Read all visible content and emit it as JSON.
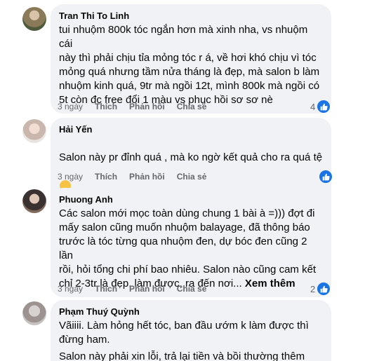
{
  "comments": [
    {
      "author": "Tran Thi To Linh",
      "text": "tui nhuộm 800k tóc ngắn hơn mà xinh nha, vs nhuộm cái\nnày thì phải chịu tỉa mỏng tóc r á, về hơi khó chịu vì tóc\nmỏng quá nhưng tầm nửa tháng là đẹp, mà salon b làm\nnhuộm kinh quá, 9tr mà ngồi 12t, mình 800k mà ngồi có\n5t còn đc free đổi 1 màu vs phục hồi sơ sơ nè",
      "time": "3 ngày",
      "like": "Thích",
      "reply": "Phản hồi",
      "share": "Chia sẻ",
      "reaction_count": "4"
    },
    {
      "author": "Hải Yến",
      "text": "Salon này pr đỉnh quá , mà ko ngờ kết quả cho ra quá tệ",
      "emoji": "crying-face-emoji",
      "time": "3 ngày",
      "like": "Thích",
      "reply": "Phản hồi",
      "share": "Chia sẻ",
      "reaction_count": ""
    },
    {
      "author": "Phuong Anh",
      "text": "Các salon mới mọc toàn dùng chung 1 bài à =))) đợt đi\nmấy salon cũng muốn nhuộm balayage, đã thông báo\ntrước là tóc từng qua nhuộm đen, dự bóc đen cũng 2 lần\nrồi, hỏi tổng chi phí bao nhiêu. Salon nào cũng cam kết\nchỉ 2-3tr là đẹp, làm được, ra đến nơi...",
      "see_more": "Xem thêm",
      "time": "3 ngày",
      "like": "Thích",
      "reply": "Phản hồi",
      "share": "Chia sẻ",
      "reaction_count": "2"
    },
    {
      "author": "Phạm Thuý Quỳnh",
      "text": "Vãiiii. Làm hỏng hết tóc, ban đầu ướm k làm được thì\nđừng ham.",
      "text2": "Salon này phải xin lỗi, trả lại tiền và bồi thường thêm cho"
    }
  ],
  "colors": {
    "bubble": "#f0f2f5",
    "meta": "#65676b",
    "like_blue": "#1b74e4"
  }
}
